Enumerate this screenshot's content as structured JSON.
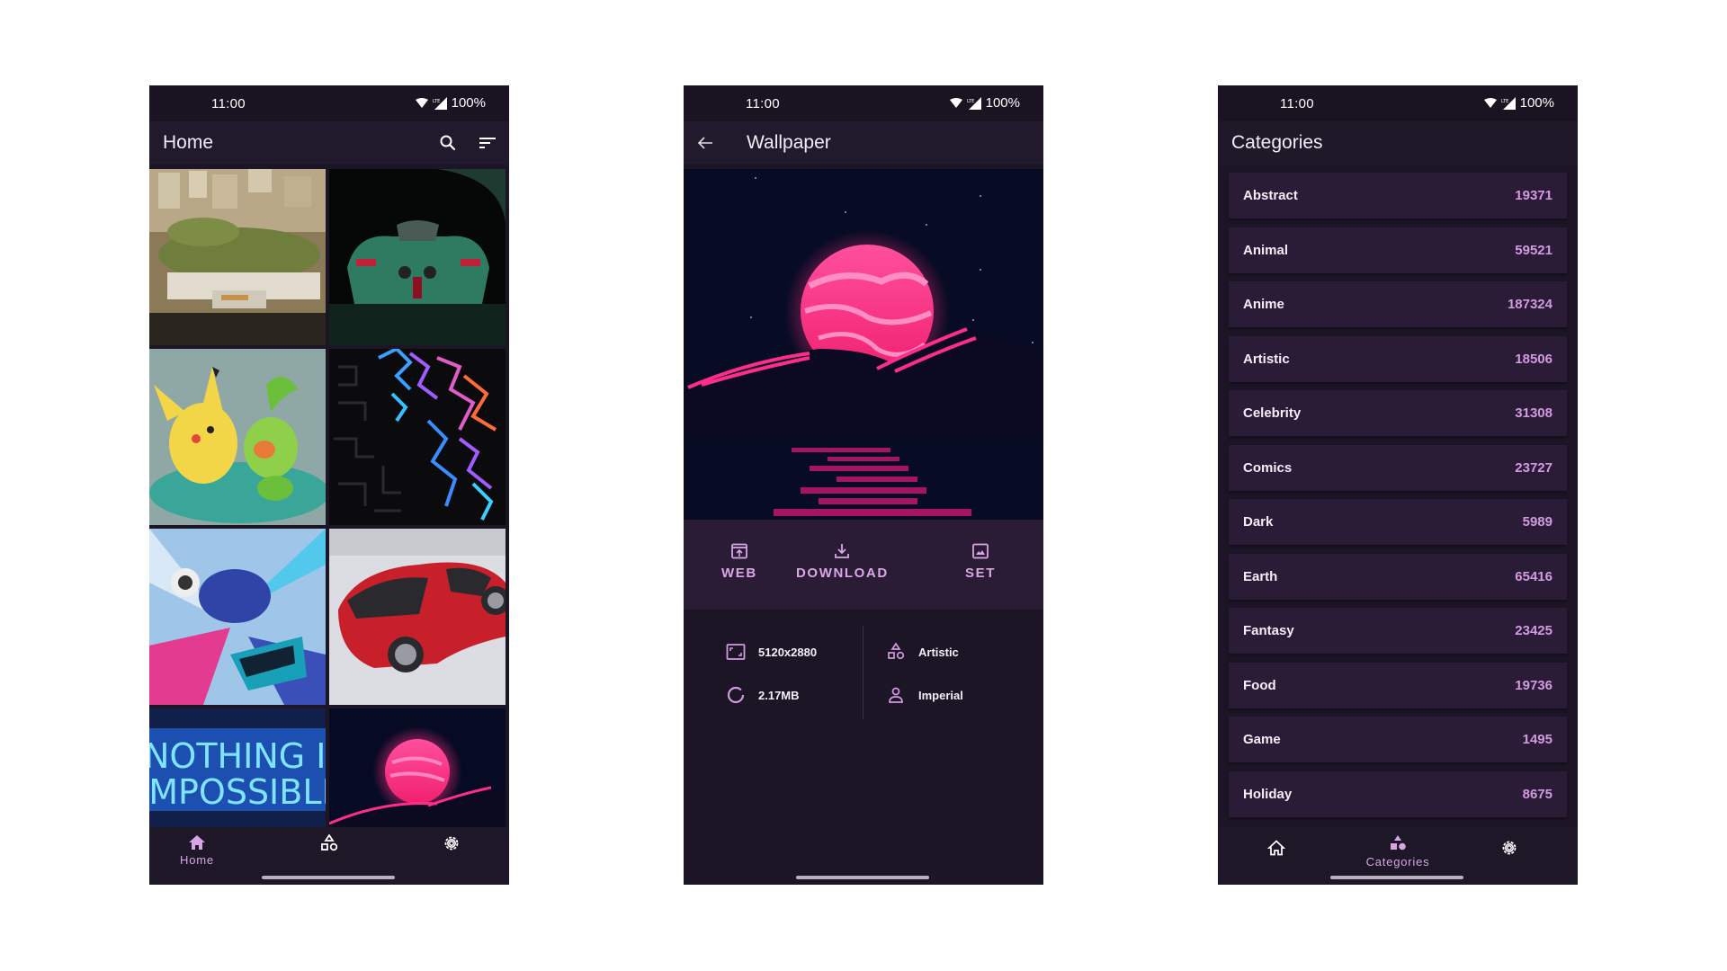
{
  "accent_color": "#d7a4e4",
  "status_bar": {
    "time": "11:00",
    "battery": "100%",
    "network": "LTE"
  },
  "home": {
    "title": "Home",
    "actions": [
      "search-icon",
      "sort-icon"
    ],
    "thumbnails": [
      {
        "subject": "aerial city coastline"
      },
      {
        "subject": "green hypercar rear view"
      },
      {
        "subject": "pikachu and grookey"
      },
      {
        "subject": "neon maze pattern"
      },
      {
        "subject": "racing car crash"
      },
      {
        "subject": "red sports car"
      },
      {
        "subject": "neon sign",
        "text_line1": "NOTHING IS",
        "text_line2": "IMPOSSIBLE"
      },
      {
        "subject": "pink planet over hills"
      }
    ],
    "nav": [
      {
        "label": "Home",
        "icon": "home-icon",
        "active": true
      },
      {
        "label": "Categories",
        "icon": "categories-icon",
        "active": false
      },
      {
        "label": "Settings",
        "icon": "settings-icon",
        "active": false
      }
    ]
  },
  "wallpaper": {
    "title": "Wallpaper",
    "back_icon": "arrow-back-icon",
    "image_subject": "pink planet rising over dark hills with reflection",
    "actions": [
      {
        "label": "WEB",
        "icon": "open-in-browser-icon"
      },
      {
        "label": "DOWNLOAD",
        "icon": "download-icon"
      },
      {
        "label": "SET",
        "icon": "wallpaper-icon"
      }
    ],
    "info": {
      "resolution": "5120x2880",
      "file_size": "2.17MB",
      "category": "Artistic",
      "author": "Imperial"
    }
  },
  "categories": {
    "title": "Categories",
    "items": [
      {
        "name": "Abstract",
        "count": "19371"
      },
      {
        "name": "Animal",
        "count": "59521"
      },
      {
        "name": "Anime",
        "count": "187324"
      },
      {
        "name": "Artistic",
        "count": "18506"
      },
      {
        "name": "Celebrity",
        "count": "31308"
      },
      {
        "name": "Comics",
        "count": "23727"
      },
      {
        "name": "Dark",
        "count": "5989"
      },
      {
        "name": "Earth",
        "count": "65416"
      },
      {
        "name": "Fantasy",
        "count": "23425"
      },
      {
        "name": "Food",
        "count": "19736"
      },
      {
        "name": "Game",
        "count": "1495"
      },
      {
        "name": "Holiday",
        "count": "8675"
      }
    ],
    "nav": [
      {
        "label": "Home",
        "icon": "home-icon",
        "active": false
      },
      {
        "label": "Categories",
        "icon": "categories-icon",
        "active": true
      },
      {
        "label": "Settings",
        "icon": "settings-icon",
        "active": false
      }
    ]
  }
}
